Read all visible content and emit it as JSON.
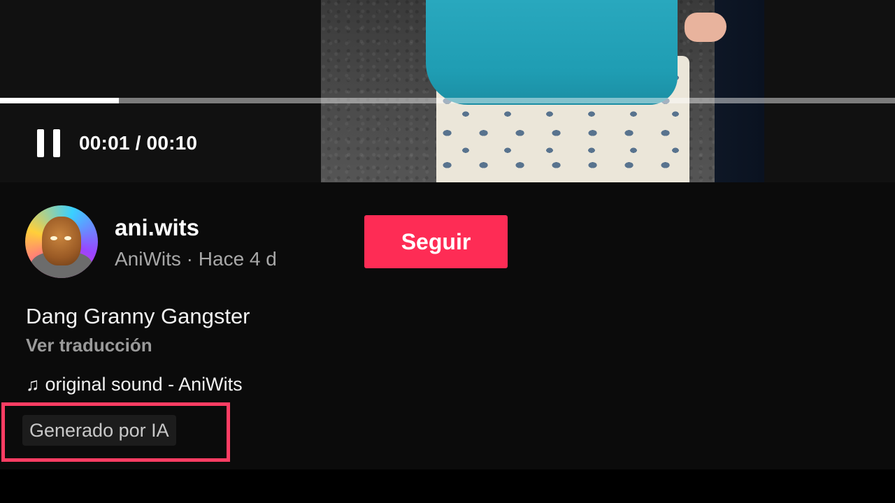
{
  "player": {
    "time_display": "00:01 / 00:10",
    "progress_fraction": 0.133,
    "state_icon": "pause-icon"
  },
  "author": {
    "username": "ani.wits",
    "subline": "AniWits · Hace 4 d",
    "follow_label": "Seguir",
    "follow_color": "#fe2c55"
  },
  "post": {
    "title": "Dang Granny Gangster",
    "translate_label": "Ver traducción",
    "music_icon": "♫",
    "sound_label": "original sound - AniWits",
    "ai_label": "Generado por IA",
    "highlight_color": "#ff3d63"
  }
}
